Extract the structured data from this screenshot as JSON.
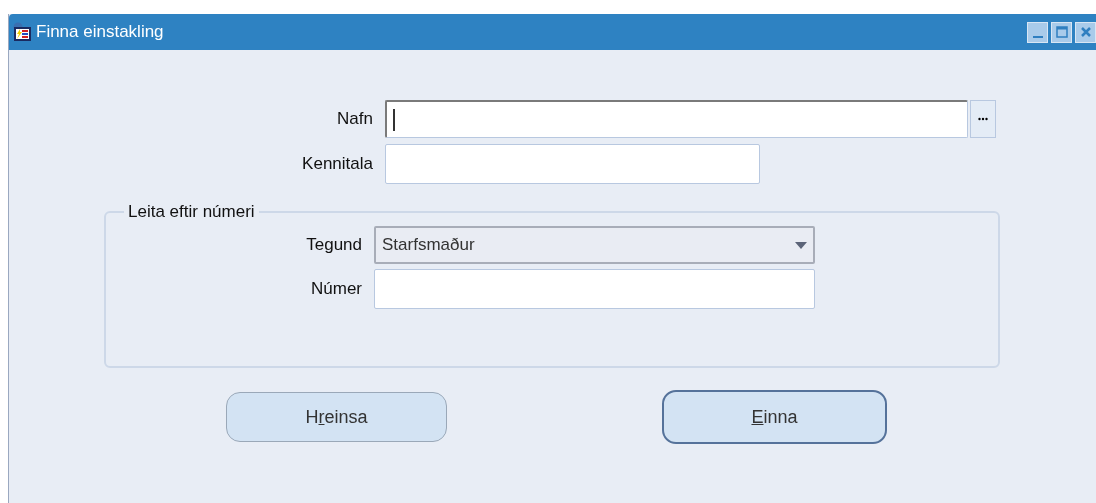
{
  "window": {
    "title": "Finna einstakling"
  },
  "fields": [
    {
      "label": "Nafn",
      "kind": "text-lov",
      "focused": true
    },
    {
      "label": "Kennitala",
      "kind": "text",
      "focused": false
    }
  ],
  "group": {
    "legend": "Leita eftir númeri",
    "fields": [
      {
        "label": "Tegund",
        "kind": "dropdown",
        "value": "Starfsmaður"
      },
      {
        "label": "Númer",
        "kind": "text",
        "focused": false
      }
    ]
  },
  "buttons": [
    {
      "prefix": "H",
      "access_key": "r",
      "suffix": "einsa",
      "default": false
    },
    {
      "access_key": "E",
      "suffix": "inna",
      "default": true
    }
  ]
}
